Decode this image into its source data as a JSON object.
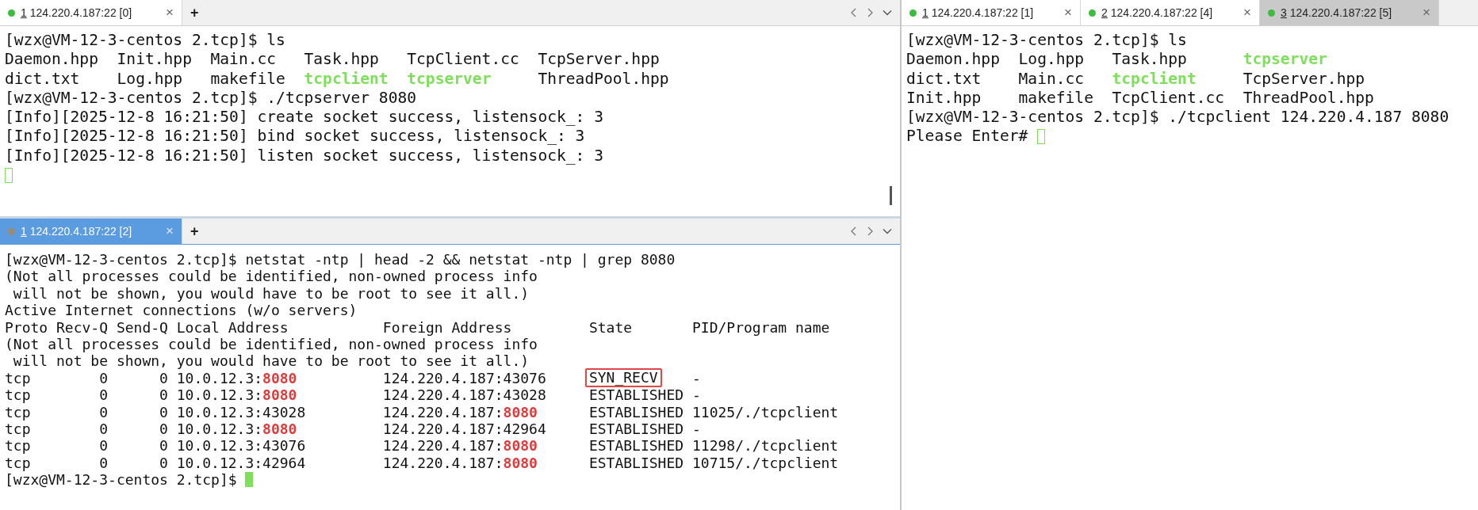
{
  "panes": [
    {
      "focused": false,
      "nav_arrows": true,
      "scrollbar": true,
      "new_tab": "+",
      "tabs": [
        {
          "number": "1",
          "label": "124.220.4.187:22 [0]",
          "close": "×",
          "color": "#3dbb3d",
          "highlighted": false
        }
      ],
      "lines": [
        [
          {
            "kind": "text",
            "text": "[wzx@VM-12-3-centos 2.tcp]$ ls"
          }
        ],
        [
          {
            "kind": "text",
            "text": "Daemon.hpp  Init.hpp  Main.cc   Task.hpp   TcpClient.cc  TcpServer.hpp"
          }
        ],
        [
          {
            "kind": "text",
            "text": "dict.txt    Log.hpp   makefile  "
          },
          {
            "kind": "exec",
            "text": "tcpclient"
          },
          {
            "kind": "exec",
            "text": "  tcpserver"
          },
          {
            "kind": "text",
            "text": "     ThreadPool.hpp"
          }
        ],
        [
          {
            "kind": "text",
            "text": "[wzx@VM-12-3-centos 2.tcp]$ ./tcpserver 8080"
          }
        ],
        [
          {
            "kind": "text",
            "text": "[Info][2025-12-8 16:21:50] create socket success, listensock_: 3"
          }
        ],
        [
          {
            "kind": "text",
            "text": "[Info][2025-12-8 16:21:50] bind socket success, listensock_: 3"
          }
        ],
        [
          {
            "kind": "text",
            "text": "[Info][2025-12-8 16:21:50] listen socket success, listensock_: 3"
          }
        ],
        [
          {
            "kind": "cursor",
            "filled": false
          }
        ]
      ]
    },
    {
      "focused": true,
      "nav_arrows": true,
      "scrollbar": false,
      "new_tab": "+",
      "tabs": [
        {
          "number": "1",
          "label": "124.220.4.187:22 [2]",
          "close": "×",
          "color": "#9a8a7a",
          "highlighted": true
        }
      ],
      "lines": [
        [
          {
            "kind": "text",
            "text": "[wzx@VM-12-3-centos 2.tcp]$ netstat -ntp | head -2 && netstat -ntp | grep 8080"
          }
        ],
        [
          {
            "kind": "text",
            "text": "(Not all processes could be identified, non-owned process info"
          }
        ],
        [
          {
            "kind": "text",
            "text": " will not be shown, you would have to be root to see it all.)"
          }
        ],
        [
          {
            "kind": "text",
            "text": "Active Internet connections (w/o servers)"
          }
        ],
        [
          {
            "kind": "text",
            "text": "Proto Recv-Q Send-Q Local Address           Foreign Address         State       PID/Program name"
          }
        ],
        [
          {
            "kind": "text",
            "text": "(Not all processes could be identified, non-owned process info"
          }
        ],
        [
          {
            "kind": "text",
            "text": " will not be shown, you would have to be root to see it all.)"
          }
        ],
        [
          {
            "kind": "text",
            "text": "tcp        0      0 10.0.12.3:"
          },
          {
            "kind": "port",
            "text": "8080"
          },
          {
            "kind": "text",
            "text": "          124.220.4.187:43076     "
          },
          {
            "kind": "boxed",
            "text": "SYN_RECV"
          },
          {
            "kind": "text",
            "text": "    -"
          }
        ],
        [
          {
            "kind": "text",
            "text": "tcp        0      0 10.0.12.3:"
          },
          {
            "kind": "port",
            "text": "8080"
          },
          {
            "kind": "text",
            "text": "          124.220.4.187:43028     ESTABLISHED -"
          }
        ],
        [
          {
            "kind": "text",
            "text": "tcp        0      0 10.0.12.3:43028         124.220.4.187:"
          },
          {
            "kind": "port",
            "text": "8080"
          },
          {
            "kind": "text",
            "text": "      ESTABLISHED 11025/./tcpclient"
          }
        ],
        [
          {
            "kind": "text",
            "text": "tcp        0      0 10.0.12.3:"
          },
          {
            "kind": "port",
            "text": "8080"
          },
          {
            "kind": "text",
            "text": "          124.220.4.187:42964     ESTABLISHED -"
          }
        ],
        [
          {
            "kind": "text",
            "text": "tcp        0      0 10.0.12.3:43076         124.220.4.187:"
          },
          {
            "kind": "port",
            "text": "8080"
          },
          {
            "kind": "text",
            "text": "      ESTABLISHED 11298/./tcpclient"
          }
        ],
        [
          {
            "kind": "text",
            "text": "tcp        0      0 10.0.12.3:42964         124.220.4.187:"
          },
          {
            "kind": "port",
            "text": "8080"
          },
          {
            "kind": "text",
            "text": "      ESTABLISHED 10715/./tcpclient"
          }
        ],
        [
          {
            "kind": "text",
            "text": "[wzx@VM-12-3-centos 2.tcp]$ "
          },
          {
            "kind": "cursor",
            "filled": true
          }
        ]
      ]
    },
    {
      "focused": false,
      "nav_arrows": false,
      "scrollbar": false,
      "tabs": [
        {
          "number": "1",
          "label": "124.220.4.187:22 [1]",
          "close": "×",
          "color": "#3dbb3d",
          "highlighted": false
        },
        {
          "number": "2",
          "label": "124.220.4.187:22 [4]",
          "close": "×",
          "color": "#3dbb3d",
          "highlighted": false
        },
        {
          "number": "3",
          "label": "124.220.4.187:22 [5]",
          "close": "×",
          "color": "#3dbb3d",
          "highlighted": true
        }
      ],
      "lines": [
        [
          {
            "kind": "text",
            "text": "[wzx@VM-12-3-centos 2.tcp]$ ls"
          }
        ],
        [
          {
            "kind": "text",
            "text": "Daemon.hpp  Log.hpp   Task.hpp      "
          },
          {
            "kind": "exec",
            "text": "tcpserver"
          }
        ],
        [
          {
            "kind": "text",
            "text": "dict.txt    Main.cc   "
          },
          {
            "kind": "exec",
            "text": "tcpclient"
          },
          {
            "kind": "text",
            "text": "     TcpServer.hpp"
          }
        ],
        [
          {
            "kind": "text",
            "text": "Init.hpp    makefile  TcpClient.cc  ThreadPool.hpp"
          }
        ],
        [
          {
            "kind": "text",
            "text": "[wzx@VM-12-3-centos 2.tcp]$ ./tcpclient 124.220.4.187 8080"
          }
        ],
        [
          {
            "kind": "text",
            "text": "Please Enter# "
          },
          {
            "kind": "cursor",
            "filled": false
          }
        ]
      ]
    }
  ]
}
